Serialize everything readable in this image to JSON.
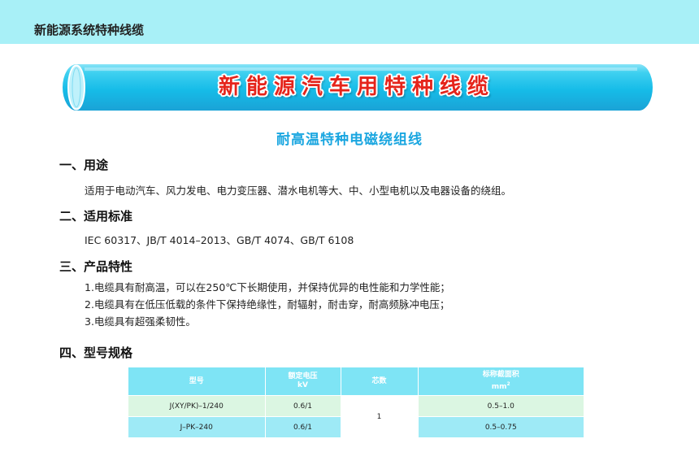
{
  "header": {
    "title": "新能源系统特种线缆"
  },
  "banner": {
    "text": "新能源汽车用特种线缆"
  },
  "subtitle": "耐高温特种电磁绕组线",
  "sections": {
    "usage": {
      "heading": "一、用途",
      "text": "适用于电动汽车、风力发电、电力变压器、潜水电机等大、中、小型电机以及电器设备的绕组。"
    },
    "standards": {
      "heading": "二、适用标准",
      "text": "IEC 60317、JB/T 4014–2013、GB/T 4074、GB/T 6108"
    },
    "features": {
      "heading": "三、产品特性",
      "items": [
        "1.电缆具有耐高温，可以在250℃下长期使用，并保持优异的电性能和力学性能；",
        "2.电缆具有在低压低载的条件下保持绝缘性，耐辐射，耐击穿，耐高频脉冲电压；",
        "3.电缆具有超强柔韧性。"
      ]
    },
    "models": {
      "heading": "四、型号规格"
    }
  },
  "table": {
    "headers": {
      "model": "型号",
      "voltage": "额定电压",
      "voltage_unit": "kV",
      "cores": "芯数",
      "area": "标称截面积",
      "area_unit": "mm",
      "area_unit_sup": "2"
    },
    "rows": [
      {
        "model": "J(XY/PK)–1/240",
        "voltage": "0.6/1",
        "area": "0.5–1.0"
      },
      {
        "model": "J–PK–240",
        "voltage": "0.6/1",
        "area": "0.5–0.75"
      }
    ],
    "cores_value": "1"
  },
  "colors": {
    "banner_cyan": "#1fc7ec",
    "header_bg": "#a8f0f7",
    "subtitle_blue": "#1aa6e0",
    "banner_text_red": "#e5241b"
  }
}
